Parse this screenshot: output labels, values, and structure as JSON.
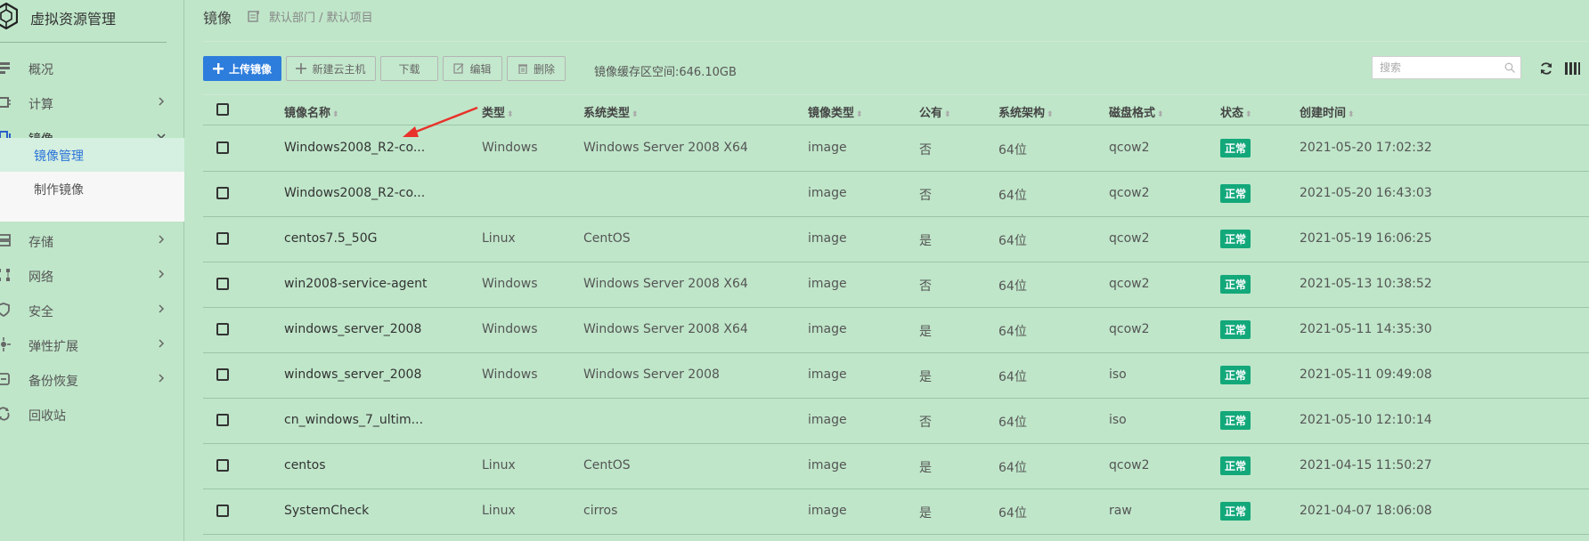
{
  "app": {
    "title": "虚拟资源管理"
  },
  "sidebar": {
    "items": [
      {
        "label": "概况",
        "icon": "overview-icon",
        "has_children": false
      },
      {
        "label": "计算",
        "icon": "compute-icon",
        "has_children": true
      },
      {
        "label": "镜像",
        "icon": "image-icon",
        "has_children": true,
        "expanded": true
      },
      {
        "label": "存储",
        "icon": "storage-icon",
        "has_children": true
      },
      {
        "label": "网络",
        "icon": "network-icon",
        "has_children": true
      },
      {
        "label": "安全",
        "icon": "security-icon",
        "has_children": true
      },
      {
        "label": "弹性扩展",
        "icon": "scaling-icon",
        "has_children": true
      },
      {
        "label": "备份恢复",
        "icon": "backup-icon",
        "has_children": true
      },
      {
        "label": "回收站",
        "icon": "recycle-icon",
        "has_children": false
      }
    ],
    "submenu": [
      {
        "label": "镜像管理",
        "current": true
      },
      {
        "label": "制作镜像",
        "current": false
      }
    ]
  },
  "header": {
    "title": "镜像",
    "breadcrumb": "默认部门 / 默认项目"
  },
  "toolbar": {
    "upload_label": "上传镜像",
    "new_vm_label": "新建云主机",
    "download_label": "下载",
    "edit_label": "编辑",
    "delete_label": "删除",
    "cache_text": "镜像缓存区空间:646.10GB",
    "search_placeholder": "搜索"
  },
  "colors": {
    "primary": "#2d7ddc",
    "status_ok": "#13a87a",
    "background": "#bfe6c9"
  },
  "table": {
    "headers": {
      "name": "镜像名称",
      "type": "类型",
      "os_type": "系统类型",
      "image_type": "镜像类型",
      "public": "公有",
      "arch": "系统架构",
      "disk_format": "磁盘格式",
      "status": "状态",
      "created": "创建时间"
    },
    "rows": [
      {
        "name": "Windows2008_R2-co...",
        "type": "Windows",
        "os_type": "Windows Server 2008 X64",
        "image_type": "image",
        "public": "否",
        "arch": "64位",
        "disk_format": "qcow2",
        "status": "正常",
        "created": "2021-05-20 17:02:32"
      },
      {
        "name": "Windows2008_R2-co...",
        "type": "",
        "os_type": "",
        "image_type": "image",
        "public": "否",
        "arch": "64位",
        "disk_format": "qcow2",
        "status": "正常",
        "created": "2021-05-20 16:43:03"
      },
      {
        "name": "centos7.5_50G",
        "type": "Linux",
        "os_type": "CentOS",
        "image_type": "image",
        "public": "是",
        "arch": "64位",
        "disk_format": "qcow2",
        "status": "正常",
        "created": "2021-05-19 16:06:25"
      },
      {
        "name": "win2008-service-agent",
        "type": "Windows",
        "os_type": "Windows Server 2008 X64",
        "image_type": "image",
        "public": "否",
        "arch": "64位",
        "disk_format": "qcow2",
        "status": "正常",
        "created": "2021-05-13 10:38:52"
      },
      {
        "name": "windows_server_2008",
        "type": "Windows",
        "os_type": "Windows Server 2008 X64",
        "image_type": "image",
        "public": "是",
        "arch": "64位",
        "disk_format": "qcow2",
        "status": "正常",
        "created": "2021-05-11 14:35:30"
      },
      {
        "name": "windows_server_2008",
        "type": "Windows",
        "os_type": "Windows Server 2008",
        "image_type": "image",
        "public": "是",
        "arch": "64位",
        "disk_format": "iso",
        "status": "正常",
        "created": "2021-05-11 09:49:08"
      },
      {
        "name": "cn_windows_7_ultim...",
        "type": "",
        "os_type": "",
        "image_type": "image",
        "public": "否",
        "arch": "64位",
        "disk_format": "iso",
        "status": "正常",
        "created": "2021-05-10 12:10:14"
      },
      {
        "name": "centos",
        "type": "Linux",
        "os_type": "CentOS",
        "image_type": "image",
        "public": "是",
        "arch": "64位",
        "disk_format": "qcow2",
        "status": "正常",
        "created": "2021-04-15 11:50:27"
      },
      {
        "name": "SystemCheck",
        "type": "Linux",
        "os_type": "cirros",
        "image_type": "image",
        "public": "是",
        "arch": "64位",
        "disk_format": "raw",
        "status": "正常",
        "created": "2021-04-07 18:06:08"
      }
    ]
  }
}
